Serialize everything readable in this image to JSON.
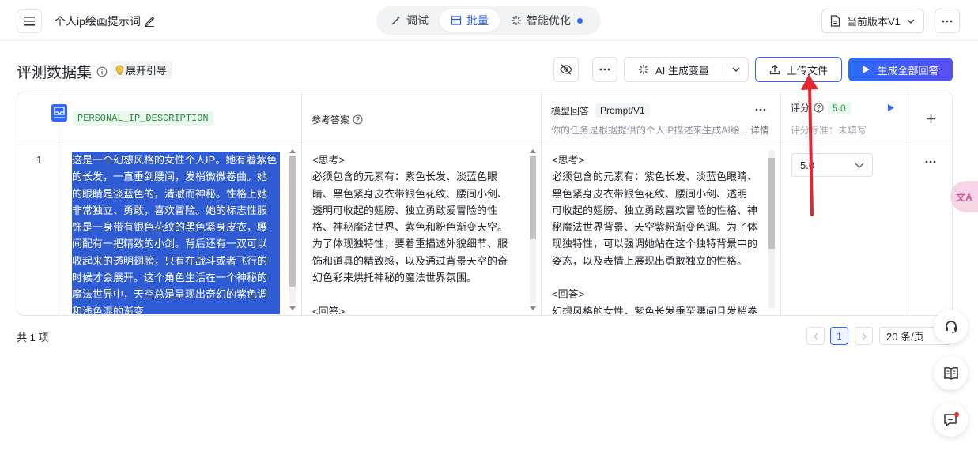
{
  "header": {
    "doc_title": "个人ip绘画提示词",
    "tabs": [
      {
        "label": "调试",
        "icon": "wand-icon"
      },
      {
        "label": "批量",
        "icon": "table-icon"
      },
      {
        "label": "智能优化",
        "icon": "sparkle-icon"
      }
    ],
    "active_tab": "批量",
    "version_label": "当前版本V1"
  },
  "toolbar": {
    "section_title": "评测数据集",
    "guide_label": "展开引导",
    "ai_generate_label": "AI 生成变量",
    "upload_label": "上传文件",
    "generate_all_label": "生成全部回答"
  },
  "table": {
    "columns": {
      "variable": "PERSONAL_IP_DESCRIPTION",
      "reference": "参考答案",
      "model_reply": "模型回答",
      "prompt_tag": "Prompt/V1",
      "prompt_desc": "你的任务是根据提供的个人IP描述来生成AI绘...",
      "detail_link": "详情",
      "score_label": "评分",
      "score_value": "5.0",
      "score_standard": "评分标准：未填写"
    },
    "rows": [
      {
        "index": "1",
        "description_lines": [
          "这是一个幻想风格的女性个人IP。她有着紫色",
          "的长发，一直垂到腰间，发梢微微卷曲。她",
          "的眼睛是淡蓝色的，清澈而神秘。性格上她",
          "非常独立、勇敢，喜欢冒险。她的标志性服",
          "饰是一身带有银色花纹的黑色紧身皮衣，腰",
          "间配有一把精致的小剑。背后还有一双可以",
          "收起来的透明翅膀，只有在战斗或者飞行的",
          "时候才会展开。这个角色生活在一个神秘的",
          "魔法世界中，天空总是呈现出奇幻的紫色调",
          "和浅色混的渐变"
        ],
        "reference_lines": [
          "<思考>",
          "必须包含的元素有：紫色长发、淡蓝色眼",
          "睛、黑色紧身皮衣带银色花纹、腰间小剑、",
          "透明可收起的翅膀、独立勇敢爱冒险的性",
          "格、神秘魔法世界、紫色和粉色渐变天空。",
          "为了体现独特性，要着重描述外貌细节、服",
          "饰和道具的精致感，以及通过背景天空的奇",
          "幻色彩来烘托神秘的魔法世界氛围。",
          "",
          "<回答>"
        ],
        "reply_lines": [
          "<思考>",
          "必须包含的元素有：紫色长发、淡蓝色眼睛、",
          "黑色紧身皮衣带银色花纹、腰间小剑、透明",
          "可收起的翅膀、独立勇敢喜欢冒险的性格、神",
          "秘魔法世界背景、天空紫粉渐变色调。为了体",
          "现独特性，可以强调她站在这个独特背景中的",
          "姿态，以及表情上展现出勇敢独立的性格。",
          "",
          "<回答>",
          "幻想风格的女性，紫色长发垂至腰间且发梢卷"
        ],
        "score": "5.0"
      }
    ]
  },
  "footer": {
    "total": "共 1 项",
    "current_page": "1",
    "page_size": "20 条/页"
  },
  "colors": {
    "accent": "#2f66ff",
    "tag_green_bg": "#e9f7ec",
    "tag_green_text": "#258a3d",
    "highlight": "#2f5bd3",
    "annotation_arrow": "#e0282e"
  }
}
